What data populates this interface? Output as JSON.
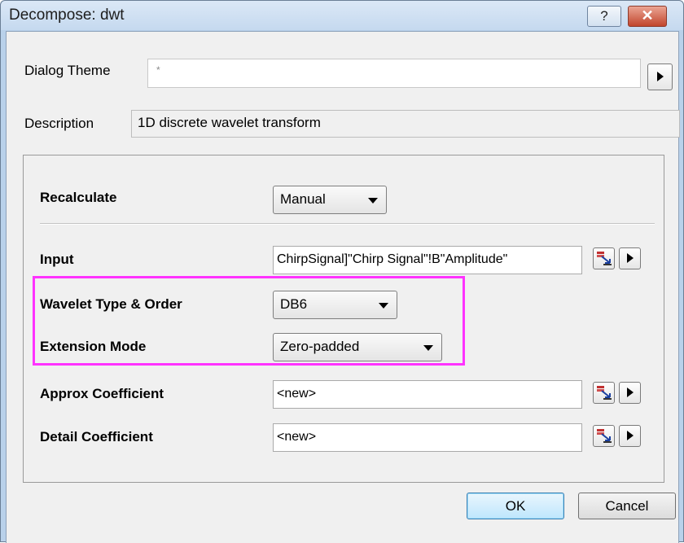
{
  "window": {
    "title": "Decompose: dwt",
    "help_label": "?",
    "close_label": "✕"
  },
  "dialog_theme": {
    "label": "Dialog Theme",
    "value": "*"
  },
  "description": {
    "label": "Description",
    "value": "1D discrete wavelet transform"
  },
  "params": {
    "recalculate": {
      "label": "Recalculate",
      "value": "Manual"
    },
    "input": {
      "label": "Input",
      "value": "ChirpSignal]\"Chirp Signal\"!B\"Amplitude\""
    },
    "wavelet": {
      "label": "Wavelet Type & Order",
      "value": "DB6"
    },
    "extension": {
      "label": "Extension Mode",
      "value": "Zero-padded"
    },
    "approx": {
      "label": "Approx Coefficient",
      "value": "<new>"
    },
    "detail": {
      "label": "Detail Coefficient",
      "value": "<new>"
    }
  },
  "buttons": {
    "ok": "OK",
    "cancel": "Cancel"
  },
  "colors": {
    "highlight": "#ff33ff",
    "titlebar": "#c5d9ef",
    "close_button": "#c1452c"
  }
}
